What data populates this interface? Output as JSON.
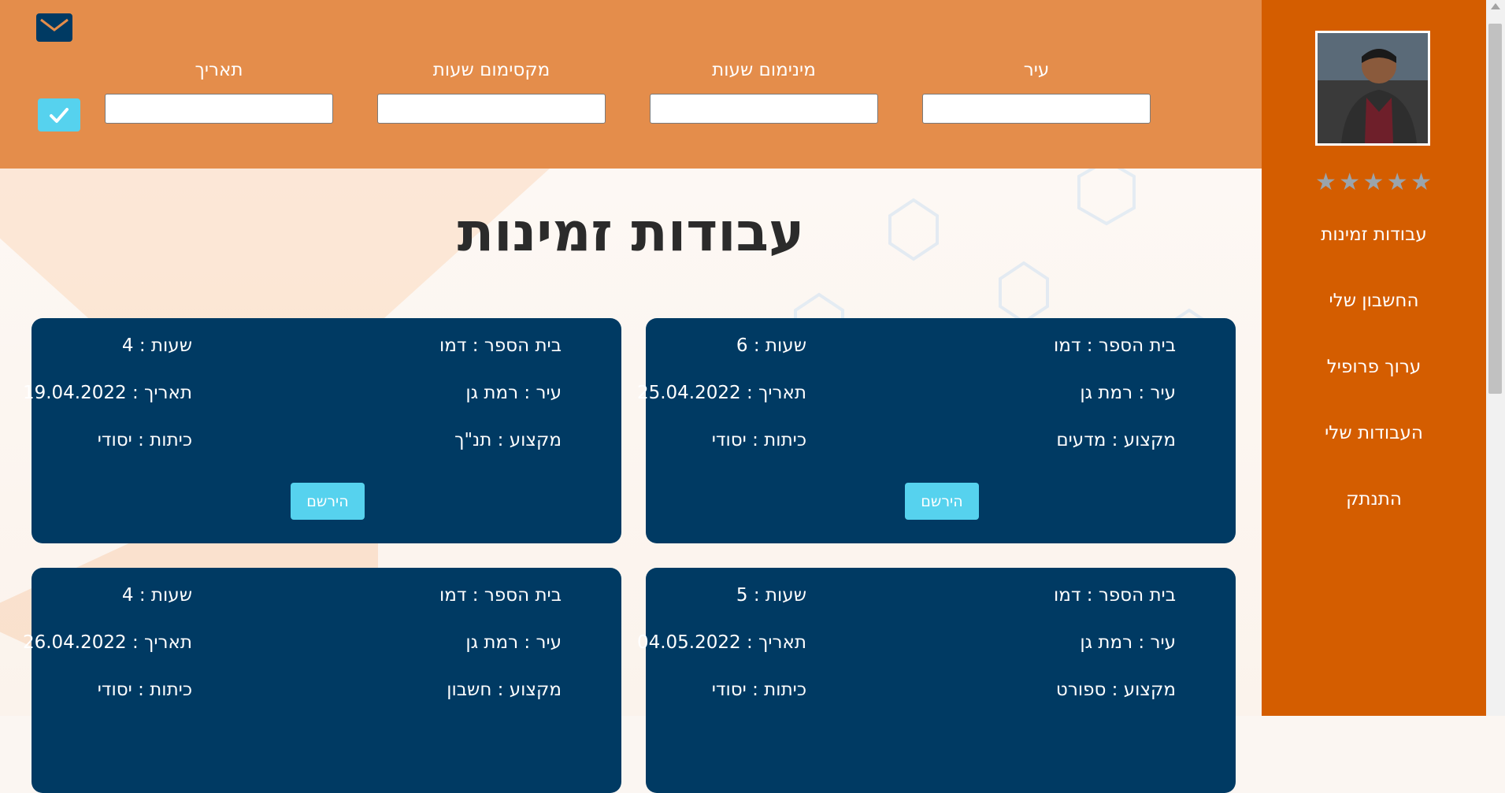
{
  "filters": {
    "city_label": "עיר",
    "min_hours_label": "מינימום שעות",
    "max_hours_label": "מקסימום שעות",
    "date_label": "תאריך",
    "city_value": "",
    "min_hours_value": "",
    "max_hours_value": "",
    "date_value": ""
  },
  "sidebar": {
    "rating_stars": [
      "★",
      "★",
      "★",
      "★",
      "★"
    ],
    "items": [
      {
        "label": "עבודות זמינות"
      },
      {
        "label": "החשבון שלי"
      },
      {
        "label": "ערוך פרופיל"
      },
      {
        "label": "העבודות שלי"
      },
      {
        "label": "התנתק"
      }
    ]
  },
  "main": {
    "title": "עבודות זמינות"
  },
  "jobs": [
    {
      "school": "בית הספר : דמו",
      "hours": "שעות : 6",
      "city": "עיר : רמת גן",
      "date": "תאריך : 25.04.2022",
      "subject": "מקצוע : מדעים",
      "grade": "כיתות : יסודי",
      "button": "הירשם"
    },
    {
      "school": "בית הספר : דמו",
      "hours": "שעות : 4",
      "city": "עיר : רמת גן",
      "date": "תאריך : 19.04.2022",
      "subject": "מקצוע : תנ\"ך",
      "grade": "כיתות : יסודי",
      "button": "הירשם"
    },
    {
      "school": "בית הספר : דמו",
      "hours": "שעות : 5",
      "city": "עיר : רמת גן",
      "date": "תאריך : 04.05.2022",
      "subject": "מקצוע : ספורט",
      "grade": "כיתות : יסודי",
      "button": ""
    },
    {
      "school": "בית הספר : דמו",
      "hours": "שעות : 4",
      "city": "עיר : רמת גן",
      "date": "תאריך : 26.04.2022",
      "subject": "מקצוע : חשבון",
      "grade": "כיתות : יסודי",
      "button": ""
    }
  ],
  "colors": {
    "topbar": "#e48d4b",
    "sidebar": "#d45d00",
    "card": "#003a63",
    "accent": "#56d2ee"
  },
  "icons": {
    "mail": "envelope-icon",
    "confirm": "check-icon"
  }
}
